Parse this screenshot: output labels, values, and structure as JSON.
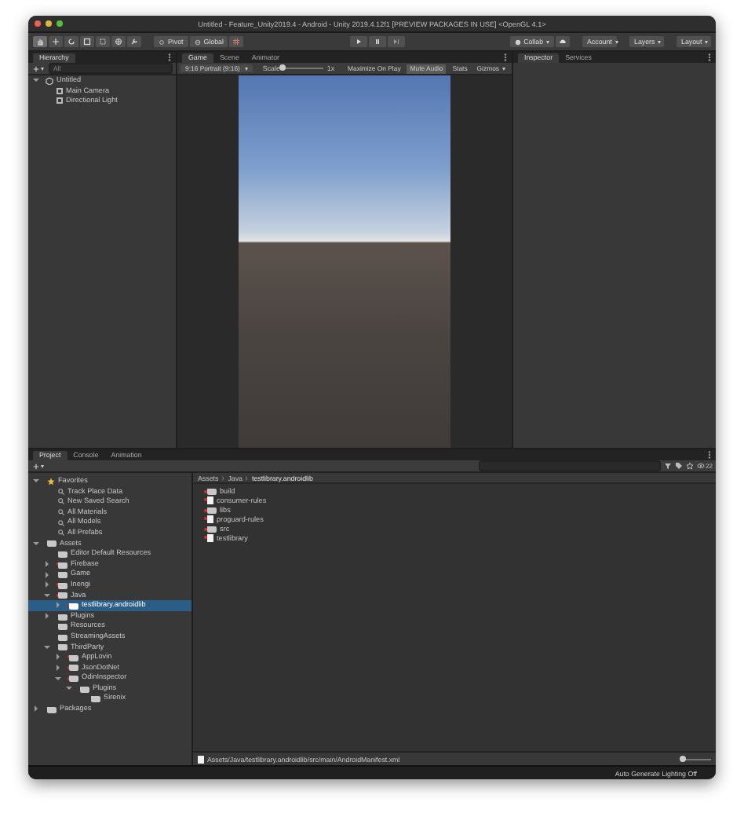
{
  "window": {
    "title": "Untitled - Feature_Unity2019.4 - Android - Unity 2019.4.12f1 [PREVIEW PACKAGES IN USE] <OpenGL 4.1>"
  },
  "toolbar": {
    "pivot": "Pivot",
    "global": "Global",
    "collab": "Collab",
    "account": "Account",
    "layers": "Layers",
    "layout": "Layout"
  },
  "hierarchy": {
    "tab": "Hierarchy",
    "search_placeholder": "All",
    "tree": [
      {
        "label": "Untitled",
        "kind": "scene",
        "expanded": true,
        "selected": false,
        "children": [
          {
            "label": "Main Camera",
            "kind": "object",
            "selected": false
          },
          {
            "label": "Directional Light",
            "kind": "object",
            "selected": false
          }
        ]
      }
    ]
  },
  "game": {
    "tabs": [
      {
        "label": "Game",
        "selected": true
      },
      {
        "label": "Scene",
        "selected": false
      },
      {
        "label": "Animator",
        "selected": false
      }
    ],
    "resolution": "9:16 Portrait (9:16)",
    "scale_label": "Scale",
    "scale": {
      "level": 0
    },
    "scale_value": "1x",
    "options": [
      {
        "label": "Maximize On Play",
        "on": false
      },
      {
        "label": "Mute Audio",
        "on": true
      },
      {
        "label": "Stats",
        "on": false
      },
      {
        "label": "Gizmos",
        "on": false
      }
    ]
  },
  "inspector": {
    "tabs": [
      {
        "label": "Inspector",
        "selected": true
      },
      {
        "label": "Services",
        "selected": false
      }
    ]
  },
  "project": {
    "tabs": [
      {
        "label": "Project",
        "selected": true
      },
      {
        "label": "Console",
        "selected": false
      },
      {
        "label": "Animation",
        "selected": false
      }
    ],
    "hidden_count": "22",
    "tree": [
      {
        "label": "Favorites",
        "kind": "star",
        "expanded": true,
        "selected": false,
        "changed": false,
        "children": [
          {
            "label": "Track Place Data",
            "kind": "search",
            "selected": false,
            "changed": false
          },
          {
            "label": "New Saved Search",
            "kind": "search",
            "selected": false,
            "changed": false
          },
          {
            "label": "All Materials",
            "kind": "search",
            "selected": false,
            "changed": false
          },
          {
            "label": "All Models",
            "kind": "search",
            "selected": false,
            "changed": false
          },
          {
            "label": "All Prefabs",
            "kind": "search",
            "selected": false,
            "changed": false
          }
        ]
      },
      {
        "label": "Assets",
        "kind": "folder",
        "expanded": true,
        "selected": false,
        "changed": false,
        "children": [
          {
            "label": "Editor Default Resources",
            "kind": "folder",
            "selected": false,
            "changed": false
          },
          {
            "label": "Firebase",
            "kind": "folder",
            "expanded": false,
            "selected": false,
            "changed": true
          },
          {
            "label": "Game",
            "kind": "folder",
            "expanded": false,
            "selected": false,
            "changed": false
          },
          {
            "label": "Inengi",
            "kind": "folder",
            "expanded": false,
            "selected": false,
            "changed": true
          },
          {
            "label": "Java",
            "kind": "folder",
            "expanded": true,
            "selected": false,
            "changed": true,
            "children": [
              {
                "label": "testlibrary.androidlib",
                "kind": "folder",
                "expanded": false,
                "selected": true,
                "changed": true
              }
            ]
          },
          {
            "label": "Plugins",
            "kind": "folder",
            "expanded": false,
            "selected": false,
            "changed": false
          },
          {
            "label": "Resources",
            "kind": "folder",
            "selected": false,
            "changed": false
          },
          {
            "label": "StreamingAssets",
            "kind": "folder",
            "selected": false,
            "changed": false
          },
          {
            "label": "ThirdParty",
            "kind": "folder",
            "expanded": true,
            "selected": false,
            "changed": false,
            "children": [
              {
                "label": "AppLovin",
                "kind": "folder",
                "expanded": false,
                "selected": false,
                "changed": true
              },
              {
                "label": "JsonDotNet",
                "kind": "folder",
                "expanded": false,
                "selected": false,
                "changed": true
              },
              {
                "label": "OdinInspector",
                "kind": "folder",
                "expanded": true,
                "selected": false,
                "changed": true,
                "children": [
                  {
                    "label": "Plugins",
                    "kind": "folder",
                    "expanded": true,
                    "selected": false,
                    "changed": false,
                    "children": [
                      {
                        "label": "Sirenix",
                        "kind": "folder",
                        "selected": false,
                        "changed": false
                      }
                    ]
                  }
                ]
              }
            ]
          }
        ]
      },
      {
        "label": "Packages",
        "kind": "folder",
        "expanded": false,
        "selected": false,
        "changed": false
      }
    ],
    "breadcrumb": [
      "Assets",
      "Java",
      "testlibrary.androidlib"
    ],
    "files": [
      {
        "label": "build",
        "kind": "folder",
        "changed": true
      },
      {
        "label": "consumer-rules",
        "kind": "file",
        "changed": true
      },
      {
        "label": "libs",
        "kind": "folder",
        "changed": true
      },
      {
        "label": "proguard-rules",
        "kind": "file",
        "changed": true
      },
      {
        "label": "src",
        "kind": "folder",
        "changed": true
      },
      {
        "label": "testlibrary",
        "kind": "file",
        "changed": true
      }
    ],
    "path": "Assets/Java/testlibrary.androidlib/src/main/AndroidManifest.xml",
    "icon_size": {
      "level": 0
    }
  },
  "status_bar": {
    "text": "Auto Generate Lighting Off"
  }
}
